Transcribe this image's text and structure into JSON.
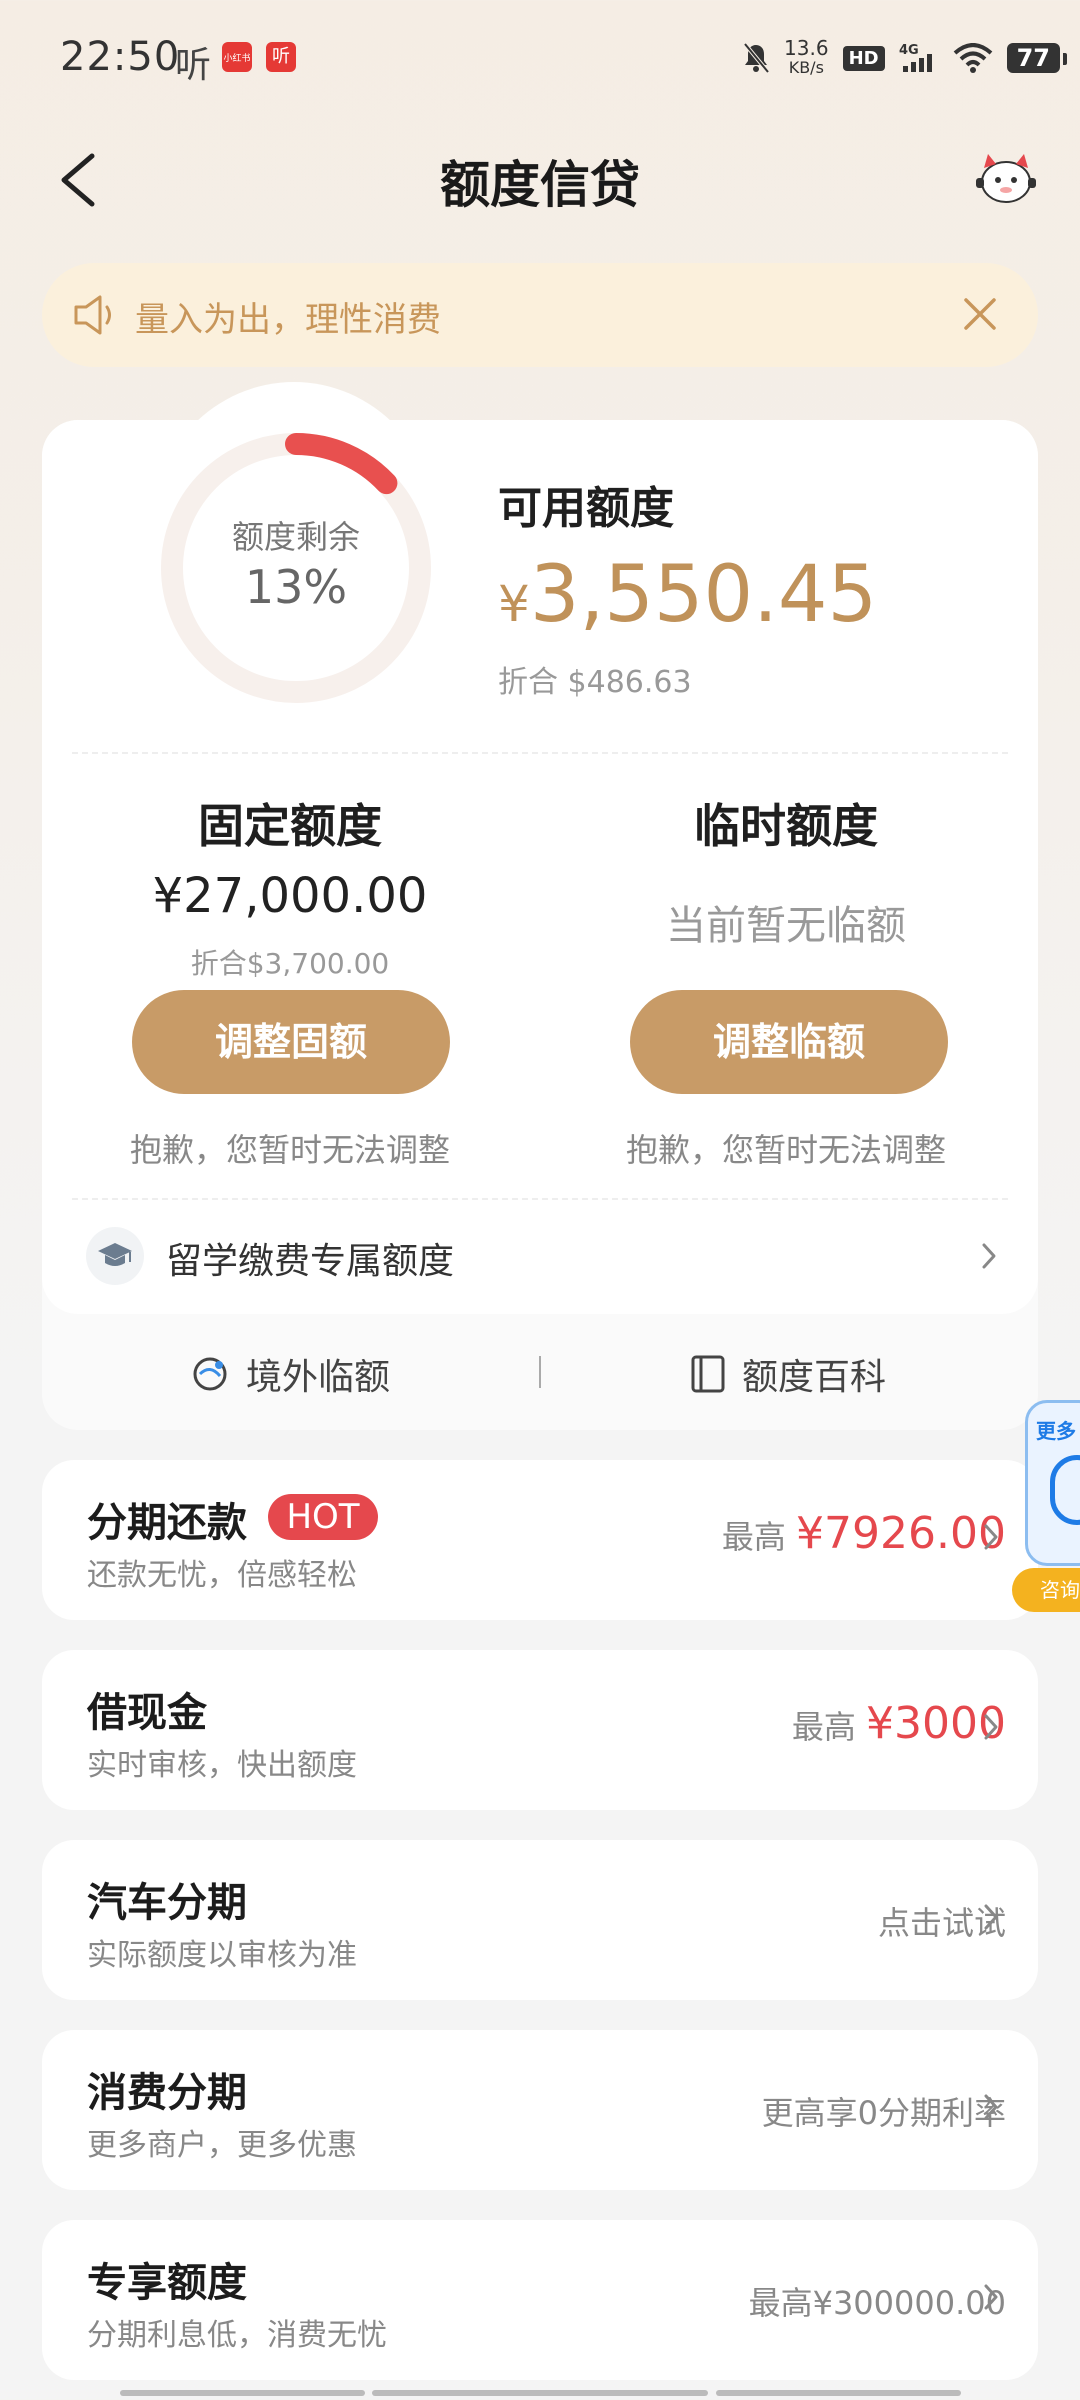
{
  "status": {
    "time": "22:50",
    "ting": "听",
    "app_badges": [
      "小红书",
      "听"
    ],
    "net_speed_value": "13.6",
    "net_speed_unit": "KB/s",
    "hd": "HD",
    "network": "4G",
    "battery": "77"
  },
  "header": {
    "title": "额度信贷"
  },
  "notice": {
    "text": "量入为出，理性消费"
  },
  "credit": {
    "ring_label": "额度剩余",
    "ring_percent": "13%",
    "remaining_fraction": 0.13,
    "available_title": "可用额度",
    "currency_symbol": "¥",
    "available_amount": "3,550.45",
    "available_usd": "折合 $486.63",
    "fixed": {
      "title": "固定额度",
      "amount": "¥27,000.00",
      "usd": "折合$3,700.00",
      "button": "调整固额",
      "note": "抱歉，您暂时无法调整"
    },
    "temporary": {
      "title": "临时额度",
      "status": "当前暂无临额",
      "button": "调整临额",
      "note": "抱歉，您暂时无法调整"
    },
    "study_abroad": "留学缴费专属额度",
    "links": {
      "overseas": "境外临额",
      "wiki": "额度百科"
    }
  },
  "items": [
    {
      "title": "分期还款",
      "badge": "HOT",
      "subtitle": "还款无忧，倍感轻松",
      "right_prefix": "最高 ",
      "right_value": "¥7926.00"
    },
    {
      "title": "借现金",
      "subtitle": "实时审核，快出额度",
      "right_prefix": "最高 ",
      "right_value": "¥3000"
    },
    {
      "title": "汽车分期",
      "subtitle": "实际额度以审核为准",
      "right_text": "点击试试"
    },
    {
      "title": "消费分期",
      "subtitle": "更多商户，更多优惠",
      "right_text": "更高享0分期利率"
    },
    {
      "title": "专享额度",
      "subtitle": "分期利息低，消费无忧",
      "right_text": "最高¥300000.00"
    }
  ],
  "float_widget": {
    "more": "更多",
    "tag": "咨询"
  },
  "colors": {
    "accent_gold": "#c89b67",
    "amount_gold": "#c0925a",
    "hot_red": "#e5484d",
    "ring_red": "#e8504f",
    "notice_bg": "#fbf0dc"
  }
}
